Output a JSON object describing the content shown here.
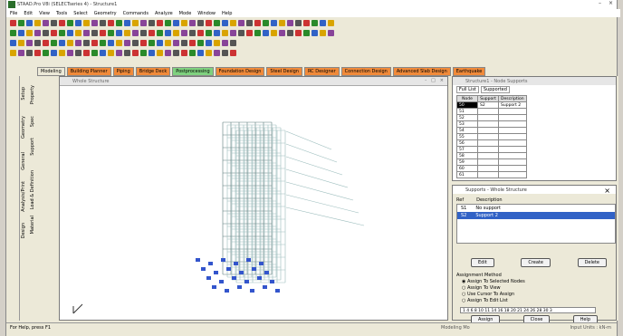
{
  "window": {
    "title": "STAAD.Pro V8i (SELECTseries 4) - Structure1",
    "controls": [
      "–",
      "×"
    ]
  },
  "menu": [
    "File",
    "Edit",
    "View",
    "Tools",
    "Select",
    "Geometry",
    "Commands",
    "Analyze",
    "Mode",
    "Window",
    "Help"
  ],
  "ribbon_tabs": [
    {
      "label": "Modeling",
      "color": "#ece9d8"
    },
    {
      "label": "Building Planner",
      "color": "#f08a3a"
    },
    {
      "label": "Piping",
      "color": "#f08a3a"
    },
    {
      "label": "Bridge Deck",
      "color": "#f08a3a"
    },
    {
      "label": "Postprocessing",
      "color": "#7fd17f"
    },
    {
      "label": "Foundation Design",
      "color": "#f08a3a"
    },
    {
      "label": "Steel Design",
      "color": "#f08a3a"
    },
    {
      "label": "RC Designer",
      "color": "#f08a3a"
    },
    {
      "label": "Connection Design",
      "color": "#f08a3a"
    },
    {
      "label": "Advanced Slab Design",
      "color": "#f08a3a"
    },
    {
      "label": "Earthquake",
      "color": "#f08a3a"
    }
  ],
  "viewport": {
    "title": "Whole Structure",
    "controls": [
      "-",
      "□",
      "×"
    ]
  },
  "side_tabs": [
    "Setup",
    "Geometry",
    "General",
    "Analysis/Print",
    "Design",
    "Property",
    "Spec",
    "Support",
    "Load & Definition",
    "Material"
  ],
  "table_window": {
    "title": "Structure1 - Node Supports",
    "tabs": [
      "Full List",
      "Supported"
    ],
    "headers": [
      "Node",
      "Support",
      "Description"
    ],
    "rows": [
      {
        "node": "50",
        "support": "S2",
        "desc": "Support 2"
      },
      {
        "node": "51",
        "support": "",
        "desc": ""
      },
      {
        "node": "52",
        "support": "",
        "desc": ""
      },
      {
        "node": "53",
        "support": "",
        "desc": ""
      },
      {
        "node": "54",
        "support": "",
        "desc": ""
      },
      {
        "node": "55",
        "support": "",
        "desc": ""
      },
      {
        "node": "56",
        "support": "",
        "desc": ""
      },
      {
        "node": "57",
        "support": "",
        "desc": ""
      },
      {
        "node": "58",
        "support": "",
        "desc": ""
      },
      {
        "node": "59",
        "support": "",
        "desc": ""
      },
      {
        "node": "60",
        "support": "",
        "desc": ""
      },
      {
        "node": "61",
        "support": "",
        "desc": ""
      }
    ]
  },
  "supports_window": {
    "title": "Supports - Whole Structure",
    "headers": [
      "Ref",
      "Description"
    ],
    "items": [
      {
        "ref": "S1",
        "desc": "No support"
      },
      {
        "ref": "S2",
        "desc": "Support 2"
      }
    ],
    "buttons": [
      "Edit",
      "Create",
      "Delete"
    ],
    "assign_label": "Assignment Method",
    "options": [
      "Assign To Selected Nodes",
      "Assign To View",
      "Use Cursor To Assign",
      "Assign To Edit List"
    ],
    "edit_list": "1 4 6 8 10 11 14 16 18 20 21 24 26 28 30 3",
    "bottom_buttons": [
      "Assign",
      "Close",
      "Help"
    ]
  },
  "status": {
    "left": "For Help, press F1",
    "mid": "Modeling Mo",
    "right": "Input Units : kN-m"
  }
}
